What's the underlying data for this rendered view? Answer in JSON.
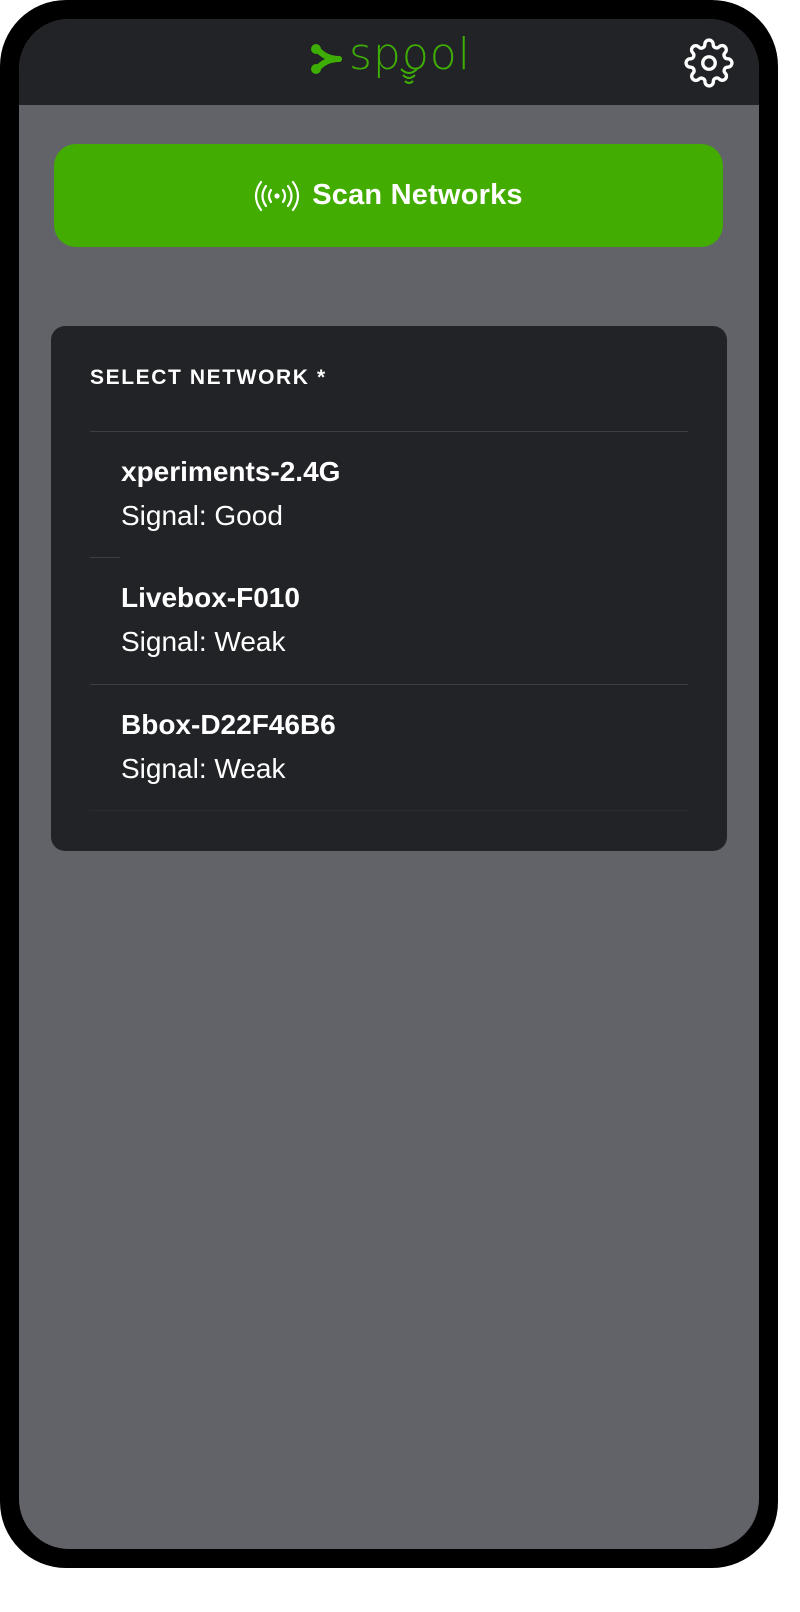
{
  "header": {
    "logo_text": "spool",
    "brand_color": "#3fae04",
    "settings_icon": "gear-icon"
  },
  "scan_button": {
    "label": "Scan Networks",
    "icon": "wifi-broadcast-icon",
    "color": "#42ac00"
  },
  "network_list": {
    "heading": "SELECT NETWORK *",
    "items": [
      {
        "name": "xperiments-2.4G",
        "signal": "Signal: Good"
      },
      {
        "name": "Livebox-F010",
        "signal": "Signal: Weak"
      },
      {
        "name": "Bbox-D22F46B6",
        "signal": "Signal: Weak"
      }
    ]
  }
}
